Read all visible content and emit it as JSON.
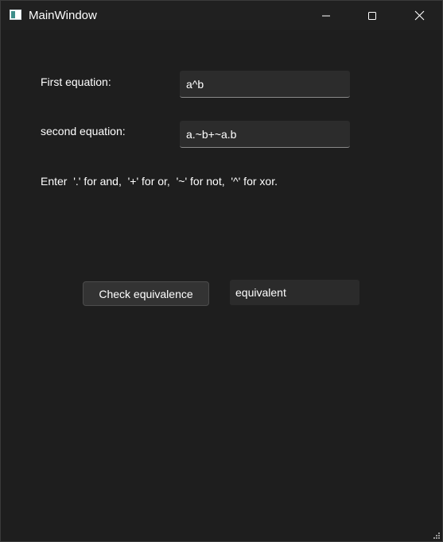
{
  "window": {
    "title": "MainWindow",
    "icons": {
      "app": "app-window-icon",
      "minimize": "minimize-icon",
      "maximize": "maximize-icon",
      "close": "close-icon",
      "grip": "resize-grip-icon"
    }
  },
  "form": {
    "first_label": "First equation:",
    "first_value": "a^b",
    "second_label": "second equation:",
    "second_value": "a.~b+~a.b",
    "hint": "Enter  '.' for and,  '+' for or,  '~' for not,  '^' for xor."
  },
  "actions": {
    "check_label": "Check equivalence",
    "result_value": "equivalent"
  },
  "colors": {
    "background": "#1e1e1e",
    "field": "#2c2c2c",
    "button": "#333333",
    "text": "#ffffff"
  }
}
